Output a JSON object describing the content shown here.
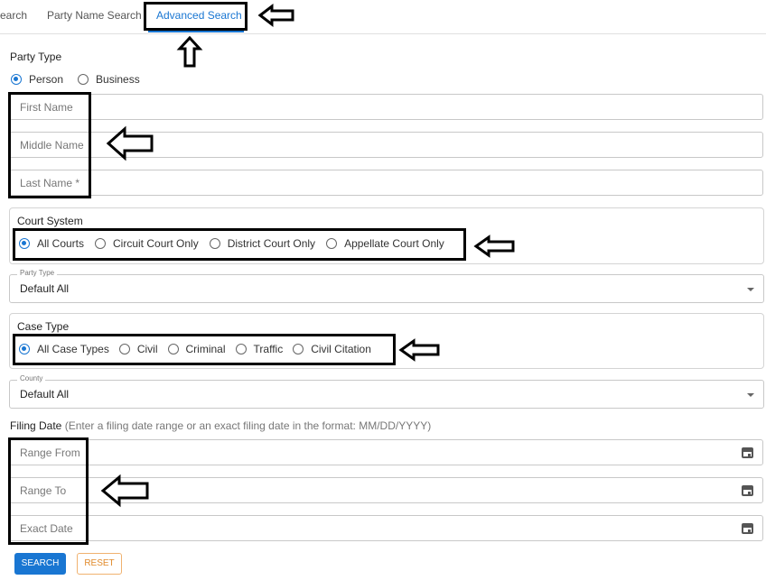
{
  "tabs": [
    "earch",
    "Party Name Search",
    "Advanced Search"
  ],
  "party_type": {
    "title": "Party Type",
    "options": [
      "Person",
      "Business"
    ],
    "selected": "Person"
  },
  "name_fields": [
    "First Name",
    "Middle Name",
    "Last Name *"
  ],
  "court_system": {
    "title": "Court System",
    "options": [
      "All Courts",
      "Circuit Court Only",
      "District Court Only",
      "Appellate Court Only"
    ],
    "selected": "All Courts"
  },
  "party_type_select": {
    "legend": "Party Type",
    "value": "Default All"
  },
  "case_type": {
    "title": "Case Type",
    "options": [
      "All Case Types",
      "Civil",
      "Criminal",
      "Traffic",
      "Civil Citation"
    ],
    "selected": "All Case Types"
  },
  "county_select": {
    "legend": "County",
    "value": "Default All"
  },
  "filing_date": {
    "title": "Filing Date",
    "hint": "(Enter a filing date range or an exact filing date in the format: MM/DD/YYYY)",
    "fields": [
      "Range From",
      "Range To",
      "Exact Date"
    ]
  },
  "buttons": {
    "search": "SEARCH",
    "reset": "RESET"
  },
  "colors": {
    "accent": "#1976d2",
    "reset": "#e08a2a",
    "annotation": "#000000"
  }
}
